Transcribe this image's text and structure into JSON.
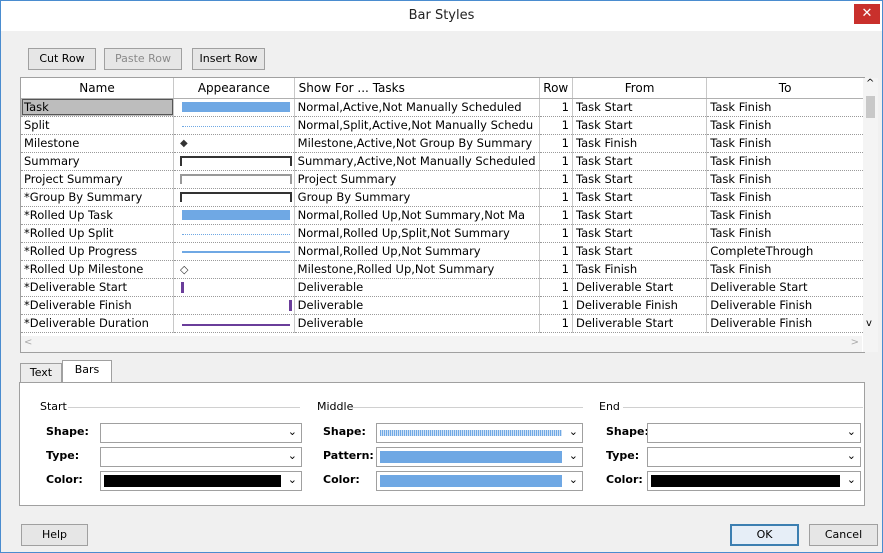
{
  "window": {
    "title": "Bar Styles",
    "close_glyph": "✕"
  },
  "toolbar": {
    "cut_row": "Cut Row",
    "paste_row": "Paste Row",
    "insert_row": "Insert Row"
  },
  "columns": [
    "Name",
    "Appearance",
    "Show For ... Tasks",
    "Row",
    "From",
    "To"
  ],
  "rows": [
    {
      "name": "Task",
      "appearance": "bar-blue",
      "show_for": "Normal,Active,Not Manually Scheduled",
      "row": "1",
      "from": "Task Start",
      "to": "Task Finish"
    },
    {
      "name": "Split",
      "appearance": "dotted-blue",
      "show_for": "Normal,Split,Active,Not Manually Schedu",
      "row": "1",
      "from": "Task Start",
      "to": "Task Finish"
    },
    {
      "name": "Milestone",
      "appearance": "diamond-filled",
      "show_for": "Milestone,Active,Not Group By Summary",
      "row": "1",
      "from": "Task Finish",
      "to": "Task Finish"
    },
    {
      "name": "Summary",
      "appearance": "summary-dark",
      "show_for": "Summary,Active,Not Manually Scheduled",
      "row": "1",
      "from": "Task Start",
      "to": "Task Finish"
    },
    {
      "name": "Project Summary",
      "appearance": "summary-gray",
      "show_for": "Project Summary",
      "row": "1",
      "from": "Task Start",
      "to": "Task Finish"
    },
    {
      "name": "*Group By Summary",
      "appearance": "summary-dark",
      "show_for": "Group By Summary",
      "row": "1",
      "from": "Task Start",
      "to": "Task Finish"
    },
    {
      "name": "*Rolled Up Task",
      "appearance": "bar-blue",
      "show_for": "Normal,Rolled Up,Not Summary,Not Ma",
      "row": "1",
      "from": "Task Start",
      "to": "Task Finish"
    },
    {
      "name": "*Rolled Up Split",
      "appearance": "dotted-blue",
      "show_for": "Normal,Rolled Up,Split,Not Summary",
      "row": "1",
      "from": "Task Start",
      "to": "Task Finish"
    },
    {
      "name": "*Rolled Up Progress",
      "appearance": "line-blue",
      "show_for": "Normal,Rolled Up,Not Summary",
      "row": "1",
      "from": "Task Start",
      "to": "CompleteThrough"
    },
    {
      "name": "*Rolled Up Milestone",
      "appearance": "diamond-outline",
      "show_for": "Milestone,Rolled Up,Not Summary",
      "row": "1",
      "from": "Task Finish",
      "to": "Task Finish"
    },
    {
      "name": "*Deliverable Start",
      "appearance": "tick-left-purple",
      "show_for": "Deliverable",
      "row": "1",
      "from": "Deliverable Start",
      "to": "Deliverable Start"
    },
    {
      "name": "*Deliverable Finish",
      "appearance": "tick-right-purple",
      "show_for": "Deliverable",
      "row": "1",
      "from": "Deliverable Finish",
      "to": "Deliverable Finish"
    },
    {
      "name": "*Deliverable Duration",
      "appearance": "line-purple",
      "show_for": "Deliverable",
      "row": "1",
      "from": "Deliverable Start",
      "to": "Deliverable Finish"
    }
  ],
  "tabs": {
    "text": "Text",
    "bars": "Bars"
  },
  "bars_panel": {
    "start": {
      "group": "Start",
      "shape_label": "Shape:",
      "type_label": "Type:",
      "color_label": "Color:",
      "color": "#000000"
    },
    "middle": {
      "group": "Middle",
      "shape_label": "Shape:",
      "pattern_label": "Pattern:",
      "color_label": "Color:",
      "color": "#6fa8e4"
    },
    "end": {
      "group": "End",
      "shape_label": "Shape:",
      "type_label": "Type:",
      "color_label": "Color:",
      "color": "#000000"
    }
  },
  "footer": {
    "help": "Help",
    "ok": "OK",
    "cancel": "Cancel"
  },
  "colors": {
    "accent_blue": "#6fa8e4",
    "purple": "#6a3d9a",
    "close_red": "#c9302c"
  }
}
